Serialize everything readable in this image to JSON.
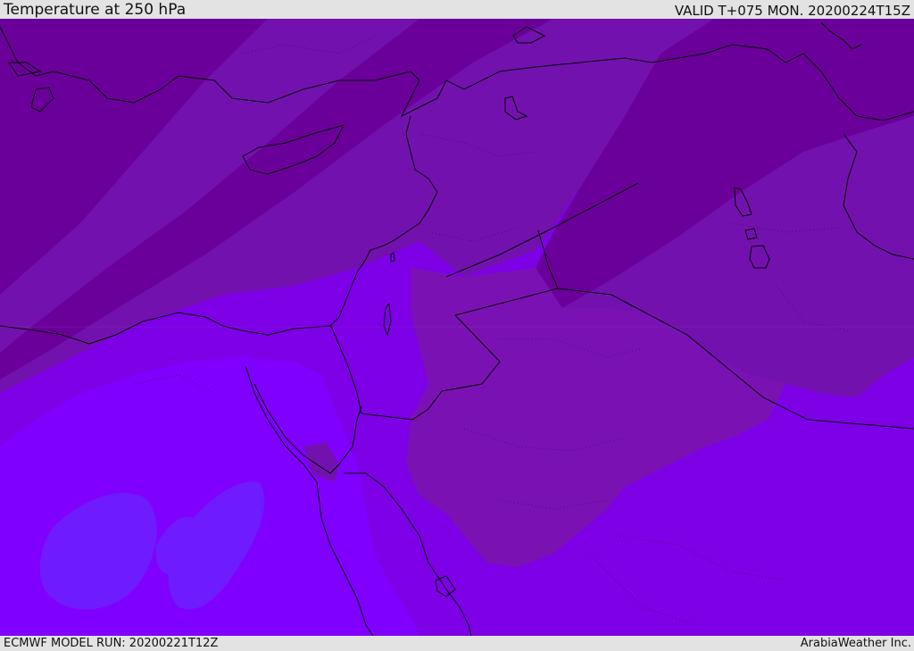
{
  "header": {
    "title": "Temperature at 250 hPa",
    "valid": "VALID T+075 MON. 20200224T15Z"
  },
  "footer": {
    "model_run": "ECMWF MODEL RUN: 20200221T12Z",
    "brand": "ArabiaWeather Inc."
  },
  "map": {
    "colors": {
      "band_darkest": "#6a0099",
      "band_dark": "#7311ae",
      "band_mid": "#7b00d7",
      "band_violet": "#7d00e6",
      "band_bright": "#8000ff",
      "band_blue_violet": "#6e1cff",
      "interior_mid": "#7a12b3",
      "coastline": "#000000",
      "borders_dotted": "#3a0a55"
    }
  }
}
